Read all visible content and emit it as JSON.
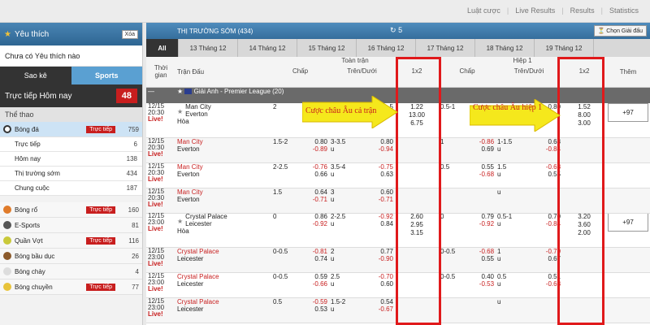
{
  "topnav": [
    "Luật cược",
    "Live Results",
    "Results",
    "Statistics"
  ],
  "sidebar": {
    "fav_title": "Yêu thích",
    "fav_clear": "Xóa",
    "fav_empty": "Chưa có Yêu thích nào",
    "tab_saoke": "Sao kê",
    "tab_sports": "Sports",
    "live_today": "Trực tiếp Hôm nay",
    "live_count": "48",
    "section": "Thể thao",
    "live_badge": "Trực tiếp",
    "soccer": {
      "name": "Bóng đá",
      "count": "759"
    },
    "soccer_sub": [
      {
        "name": "Trực tiếp",
        "count": "6"
      },
      {
        "name": "Hôm nay",
        "count": "138"
      },
      {
        "name": "Thị trường sớm",
        "count": "434"
      },
      {
        "name": "Chung cuộc",
        "count": "187"
      }
    ],
    "sports": [
      {
        "name": "Bóng rổ",
        "live": true,
        "count": "160",
        "color": "#e07b2a"
      },
      {
        "name": "E-Sports",
        "live": false,
        "count": "81",
        "color": "#555555"
      },
      {
        "name": "Quần Vợt",
        "live": true,
        "count": "116",
        "color": "#c9c93a"
      },
      {
        "name": "Bóng bầu dục",
        "live": false,
        "count": "26",
        "color": "#8b5a2b"
      },
      {
        "name": "Bóng chày",
        "live": false,
        "count": "4",
        "color": "#dddddd"
      },
      {
        "name": "Bóng chuyền",
        "live": true,
        "count": "77",
        "color": "#e8c33a"
      }
    ]
  },
  "main": {
    "title": "THỊ TRƯỜNG SỚM (434)",
    "refresh": "5",
    "choose_league": "Chọn Giải đấu",
    "dates": [
      "All",
      "13 Tháng 12",
      "14 Tháng 12",
      "15 Tháng 12",
      "16 Tháng 12",
      "17 Tháng 12",
      "18 Tháng 12",
      "19 Tháng 12"
    ],
    "cols": {
      "time": "Thời gian",
      "match": "Trận Đấu",
      "full": "Toàn trận",
      "half": "Hiệp 1",
      "hdp": "Chấp",
      "ou": "Trên/Dưới",
      "x12": "1x2",
      "more": "Thêm"
    },
    "league": "Giải Anh - Premier League (20)",
    "league2_count": "(20)",
    "annotation_full": "Cược châu Âu cả trận",
    "annotation_half": "Cược châu Âu hiệp 1",
    "matches": [
      {
        "date": "12/15",
        "time": "20:30",
        "live": "Live!",
        "home": "Man City",
        "away": "Everton",
        "draw": "Hòa",
        "hdp": "2",
        "hdp_odds": [
          "",
          ""
        ],
        "ou": "",
        "ou_odds": [
          "",
          "5"
        ],
        "x12": [
          "1.22",
          "13.00",
          "6.75"
        ],
        "h_hdp": "0.5-1",
        "h_hdp_odds": [
          "",
          ""
        ],
        "h_ou": "",
        "h_ou_odds": [
          "",
          "0.80"
        ],
        "h_x12": [
          "1.52",
          "8.00",
          "3.00"
        ],
        "more": "+97",
        "red": false
      },
      {
        "date": "12/15",
        "time": "20:30",
        "live": "Live!",
        "home": "Man City",
        "away": "Everton",
        "hdp": "1.5-2",
        "hdp_odds": [
          "0.80",
          "-0.89"
        ],
        "ou": "3-3.5",
        "ou_odds": [
          "0.80",
          "-0.94"
        ],
        "ou_u": "u",
        "h_hdp": "1",
        "h_hdp_odds": [
          "-0.86",
          "0.69"
        ],
        "h_ou": "1-1.5",
        "h_ou_odds": [
          "0.68",
          "-0.84"
        ],
        "red": true
      },
      {
        "date": "12/15",
        "time": "20:30",
        "live": "Live!",
        "home": "Man City",
        "away": "Everton",
        "hdp": "2-2.5",
        "hdp_odds": [
          "-0.76",
          "0.66"
        ],
        "ou": "3.5-4",
        "ou_odds": [
          "-0.75",
          "0.63"
        ],
        "ou_u": "u",
        "h_hdp": "0.5",
        "h_hdp_odds": [
          "0.55",
          "-0.68"
        ],
        "h_ou": "1.5",
        "h_ou_odds": [
          "-0.68",
          "0.55"
        ],
        "red": true
      },
      {
        "date": "12/15",
        "time": "20:30",
        "live": "Live!",
        "home": "Man City",
        "away": "Everton",
        "hdp": "1.5",
        "hdp_odds": [
          "0.64",
          "-0.71"
        ],
        "ou": "3",
        "ou_odds": [
          "0.60",
          "-0.71"
        ],
        "ou_u": "u",
        "h_hdp": "",
        "h_hdp_odds": [
          "",
          ""
        ],
        "h_ou": "",
        "h_ou_odds": [
          "",
          ""
        ],
        "red": true
      },
      {
        "date": "12/15",
        "time": "23:00",
        "live": "Live!",
        "home": "Crystal Palace",
        "away": "Leicester",
        "draw": "Hòa",
        "hdp": "0",
        "hdp_odds": [
          "0.86",
          "-0.92"
        ],
        "ou": "2-2.5",
        "ou_odds": [
          "-0.92",
          "0.84"
        ],
        "ou_u": "u",
        "x12": [
          "2.60",
          "2.95",
          "3.15"
        ],
        "h_hdp": "0",
        "h_hdp_odds": [
          "0.79",
          "-0.92"
        ],
        "h_ou": "0.5-1",
        "h_ou_odds": [
          "0.70",
          "-0.84"
        ],
        "h_x12": [
          "3.20",
          "3.60",
          "2.00"
        ],
        "more": "+97",
        "red": false
      },
      {
        "date": "12/15",
        "time": "23:00",
        "live": "Live!",
        "home": "Crystal Palace",
        "away": "Leicester",
        "hdp": "0-0.5",
        "hdp_odds": [
          "-0.81",
          "0.74"
        ],
        "ou": "2",
        "ou_odds": [
          "0.77",
          "-0.90"
        ],
        "ou_u": "u",
        "h_hdp": "0-0.5",
        "h_hdp_odds": [
          "-0.68",
          "0.55"
        ],
        "h_ou": "1",
        "h_ou_odds": [
          "-0.79",
          "0.67"
        ],
        "red": true
      },
      {
        "date": "12/15",
        "time": "23:00",
        "live": "Live!",
        "home": "Crystal Palace",
        "away": "Leicester",
        "hdp": "0-0.5",
        "hdp_odds": [
          "0.59",
          "-0.66"
        ],
        "ou": "2.5",
        "ou_odds": [
          "-0.70",
          "0.60"
        ],
        "ou_u": "u",
        "h_hdp": "0-0.5",
        "h_hdp_odds": [
          "0.40",
          "-0.53"
        ],
        "h_ou": "0.5",
        "h_ou_odds": [
          "0.51",
          "-0.63"
        ],
        "red": true
      },
      {
        "date": "12/15",
        "time": "23:00",
        "live": "Live!",
        "home": "Crystal Palace",
        "away": "Leicester",
        "hdp": "0.5",
        "hdp_odds": [
          "-0.59",
          "0.53"
        ],
        "ou": "1.5-2",
        "ou_odds": [
          "0.54",
          "-0.67"
        ],
        "ou_u": "u",
        "h_hdp": "",
        "h_hdp_odds": [
          "",
          ""
        ],
        "h_ou": "",
        "h_ou_odds": [
          "",
          ""
        ],
        "red": true
      }
    ]
  }
}
